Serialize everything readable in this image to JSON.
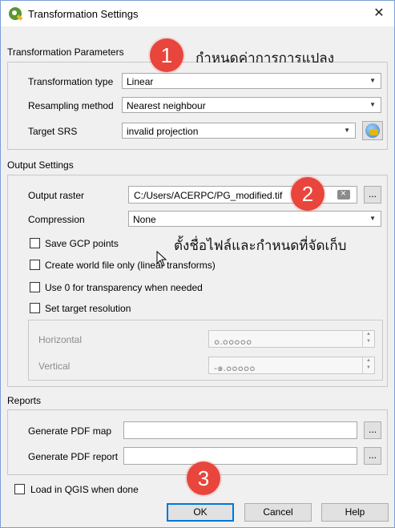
{
  "window": {
    "title": "Transformation Settings",
    "close_glyph": "✕"
  },
  "transformation_parameters": {
    "group_title": "Transformation Parameters",
    "transformation_type_label": "Transformation type",
    "transformation_type_value": "Linear",
    "resampling_method_label": "Resampling method",
    "resampling_method_value": "Nearest neighbour",
    "target_srs_label": "Target SRS",
    "target_srs_value": "invalid projection"
  },
  "output_settings": {
    "group_title": "Output Settings",
    "output_raster_label": "Output raster",
    "output_raster_value": "C:/Users/ACERPC/PG_modified.tif",
    "browse_label": "...",
    "compression_label": "Compression",
    "compression_value": "None",
    "checkboxes": [
      {
        "label": "Save GCP points",
        "checked": false
      },
      {
        "label": "Create world file only (linear transforms)",
        "checked": false
      },
      {
        "label": "Use 0 for transparency when needed",
        "checked": false
      },
      {
        "label": "Set target resolution",
        "checked": false
      }
    ],
    "horizontal_label": "Horizontal",
    "horizontal_value": "๐.๐๐๐๐๐",
    "vertical_label": "Vertical",
    "vertical_value": "-๑.๐๐๐๐๐"
  },
  "reports": {
    "group_title": "Reports",
    "pdf_map_label": "Generate PDF map",
    "pdf_report_label": "Generate PDF report",
    "browse_label": "..."
  },
  "load_in_qgis_label": "Load in QGIS when done",
  "buttons": {
    "ok": "OK",
    "cancel": "Cancel",
    "help": "Help"
  },
  "annotations": {
    "badge1": "1",
    "badge1_text": "กำหนดค่าการการแปลง",
    "badge2": "2",
    "badge2_text": "ตั้งชื่อไฟล์และกำหนดที่จัดเก็บ",
    "badge3": "3"
  },
  "colors": {
    "badge": "#e8453c",
    "accent": "#0078d7",
    "qgis_green": "#589632"
  }
}
